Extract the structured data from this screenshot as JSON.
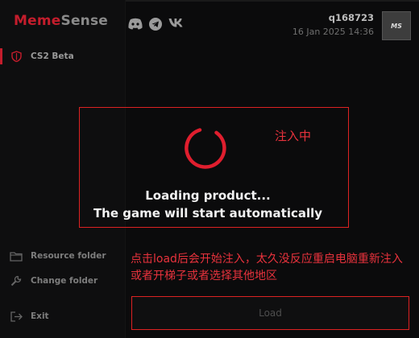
{
  "app": {
    "brand_part1": "Meme",
    "brand_part2": "Sense"
  },
  "sidebar": {
    "product": {
      "label": "CS2 Beta",
      "icon": "shield-icon"
    },
    "bottom_items": [
      {
        "label": "Resource folder",
        "icon": "folder-icon"
      },
      {
        "label": "Change folder",
        "icon": "wrench-icon"
      },
      {
        "label": "Exit",
        "icon": "exit-icon"
      }
    ]
  },
  "header": {
    "social_icons": [
      "discord-icon",
      "telegram-icon",
      "vk-icon"
    ],
    "username": "q168723",
    "datetime": "16 Jan 2025 14:36",
    "avatar_text": "MS"
  },
  "loading": {
    "line1": "Loading product...",
    "line2": "The game will start automatically"
  },
  "annotations": {
    "injecting": "注入中",
    "instruction": "点击load后会开始注入，太久没反应重启电脑重新注入或者开梯子或者选择其他地区"
  },
  "main": {
    "load_button": "Load"
  },
  "colors": {
    "accent": "#c41d2c",
    "annotation": "#e8323c",
    "background": "#0b0b0c"
  }
}
